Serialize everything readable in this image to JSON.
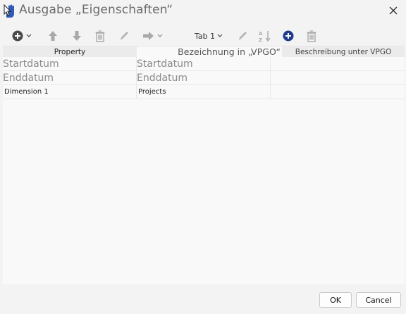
{
  "window": {
    "title": "Ausgabe „Eigenschaften“"
  },
  "toolbar": {
    "tab_select": "Tab 1"
  },
  "columns": {
    "property": "Property",
    "bezeichnung": "Bezeichnung in „VPGO“",
    "beschreibung": "Beschreibung unter VPGO"
  },
  "rows": [
    {
      "property": "Startdatum",
      "bezeichnung": "Startdatum",
      "beschreibung": ""
    },
    {
      "property": "Enddatum",
      "bezeichnung": "Enddatum",
      "beschreibung": ""
    },
    {
      "property": "Dimension 1",
      "bezeichnung": "Projects",
      "beschreibung": ""
    }
  ],
  "footer": {
    "ok_label": "OK",
    "cancel_label": "Cancel"
  },
  "colors": {
    "accent": "#1f3a8a",
    "icon_gray": "#a9a9a9",
    "icon_dark": "#4a4a4a"
  }
}
